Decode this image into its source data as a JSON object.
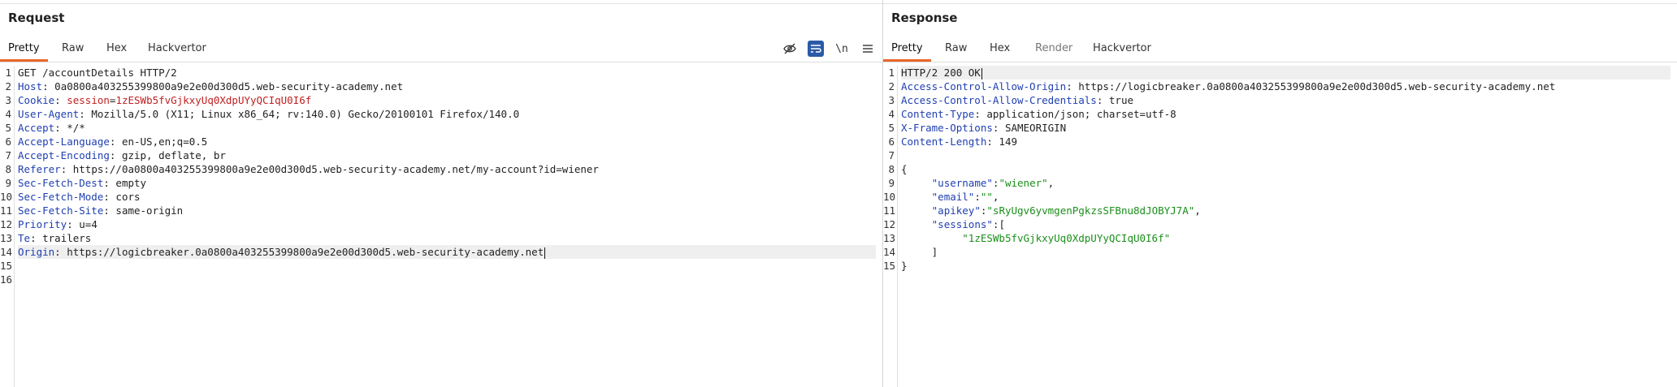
{
  "request": {
    "title": "Request",
    "tabs": [
      {
        "label": "Pretty"
      },
      {
        "label": "Raw"
      },
      {
        "label": "Hex"
      },
      {
        "label": "Hackvertor"
      }
    ],
    "toolbar_newline_label": "\\n",
    "lines": [
      {
        "n": "1",
        "key": "",
        "sep": "",
        "val": "GET /accountDetails HTTP/2"
      },
      {
        "n": "2",
        "key": "Host",
        "sep": ": ",
        "val": "0a0800a403255399800a9e2e00d300d5.web-security-academy.net"
      },
      {
        "n": "3",
        "key": "Cookie",
        "sep": ": ",
        "val": "",
        "cookie_name": "session",
        "cookie_val": "1zESWb5fvGjkxyUq0XdpUYyQCIqU0I6f"
      },
      {
        "n": "4",
        "key": "User-Agent",
        "sep": ": ",
        "val": "Mozilla/5.0 (X11; Linux x86_64; rv:140.0) Gecko/20100101 Firefox/140.0"
      },
      {
        "n": "5",
        "key": "Accept",
        "sep": ": ",
        "val": "*/*"
      },
      {
        "n": "6",
        "key": "Accept-Language",
        "sep": ": ",
        "val": "en-US,en;q=0.5"
      },
      {
        "n": "7",
        "key": "Accept-Encoding",
        "sep": ": ",
        "val": "gzip, deflate, br"
      },
      {
        "n": "8",
        "key": "Referer",
        "sep": ": ",
        "val": "https://0a0800a403255399800a9e2e00d300d5.web-security-academy.net/my-account?id=wiener"
      },
      {
        "n": "9",
        "key": "Sec-Fetch-Dest",
        "sep": ": ",
        "val": "empty"
      },
      {
        "n": "10",
        "key": "Sec-Fetch-Mode",
        "sep": ": ",
        "val": "cors"
      },
      {
        "n": "11",
        "key": "Sec-Fetch-Site",
        "sep": ": ",
        "val": "same-origin"
      },
      {
        "n": "12",
        "key": "Priority",
        "sep": ": ",
        "val": "u=4"
      },
      {
        "n": "13",
        "key": "Te",
        "sep": ": ",
        "val": "trailers"
      },
      {
        "n": "14",
        "key": "Origin",
        "sep": ": ",
        "val": "https://logicbreaker.0a0800a403255399800a9e2e00d300d5.web-security-academy.net"
      },
      {
        "n": "15",
        "key": "",
        "sep": "",
        "val": ""
      },
      {
        "n": "16",
        "key": "",
        "sep": "",
        "val": ""
      }
    ]
  },
  "response": {
    "title": "Response",
    "tabs": [
      {
        "label": "Pretty"
      },
      {
        "label": "Raw"
      },
      {
        "label": "Hex"
      },
      {
        "label": "Render"
      },
      {
        "label": "Hackvertor"
      }
    ],
    "lines": [
      {
        "n": "1",
        "key": "",
        "sep": "",
        "val": "HTTP/2 200 OK"
      },
      {
        "n": "2",
        "key": "Access-Control-Allow-Origin",
        "sep": ": ",
        "val": "https://logicbreaker.0a0800a403255399800a9e2e00d300d5.web-security-academy.net"
      },
      {
        "n": "3",
        "key": "Access-Control-Allow-Credentials",
        "sep": ": ",
        "val": "true"
      },
      {
        "n": "4",
        "key": "Content-Type",
        "sep": ": ",
        "val": "application/json; charset=utf-8"
      },
      {
        "n": "5",
        "key": "X-Frame-Options",
        "sep": ": ",
        "val": "SAMEORIGIN"
      },
      {
        "n": "6",
        "key": "Content-Length",
        "sep": ": ",
        "val": "149"
      },
      {
        "n": "7",
        "key": "",
        "sep": "",
        "val": ""
      },
      {
        "n": "8",
        "key": "",
        "sep": "",
        "val": "{"
      },
      {
        "n": "9",
        "key": "\"username\"",
        "sep": ":",
        "val": "\"wiener\"",
        "tail": ","
      },
      {
        "n": "10",
        "key": "\"email\"",
        "sep": ":",
        "val": "\"\"",
        "tail": ","
      },
      {
        "n": "11",
        "key": "\"apikey\"",
        "sep": ":",
        "val": "\"sRyUgv6yvmgenPgkzsSFBnu8dJOBYJ7A\"",
        "tail": ","
      },
      {
        "n": "12",
        "key": "\"sessions\"",
        "sep": ":",
        "val": "",
        "tail": "["
      },
      {
        "n": "13",
        "key": "",
        "sep": "",
        "val": "\"1zESWb5fvGjkxyUq0XdpUYyQCIqU0I6f\"",
        "tail": ""
      },
      {
        "n": "14",
        "key": "",
        "sep": "",
        "val": "]"
      },
      {
        "n": "15",
        "key": "",
        "sep": "",
        "val": "}"
      }
    ]
  },
  "colors": {
    "accent_tab": "#e8682c",
    "header_key": "#1f3fb0",
    "cookie": "#c01f1f",
    "json_string": "#1a8f1a",
    "toggle_on": "#2b5aa6"
  }
}
